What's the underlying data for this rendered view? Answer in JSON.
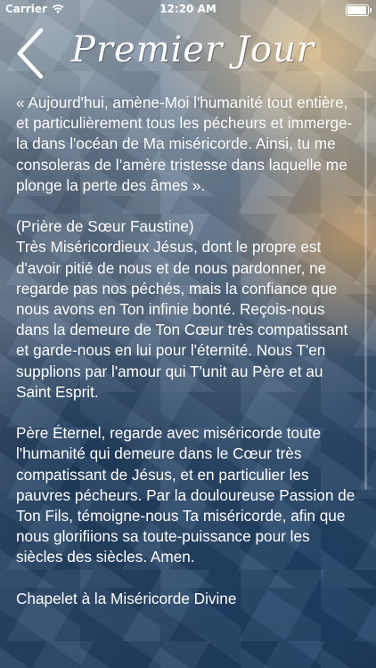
{
  "status_bar": {
    "carrier": "Carrier",
    "time": "12:20 AM"
  },
  "header": {
    "title": "Premier Jour"
  },
  "content": {
    "paragraph_1": "« Aujourd'hui, amène-Moi l'humanité tout entière, et particulièrement tous les pécheurs et immerge-la dans l'océan de Ma miséricorde. Ainsi, tu me consoleras de l’amère tristesse dans laquelle me plonge la perte des âmes ».",
    "prayer_heading": "(Prière de Sœur Faustine)",
    "prayer_body": "Très Miséricordieux Jésus, dont le propre est d'avoir pitié de nous et de nous pardonner, ne regarde pas nos péchés, mais la confiance que nous avons en Ton infinie bonté. Reçois-nous dans la demeure de Ton Cœur très compatissant et garde-nous en lui pour l'éternité. Nous T'en supplions par l'amour qui T'unit au Père et au Saint Esprit.",
    "paragraph_3": "Père Éternel, regarde avec miséricorde toute l'humanité qui demeure dans le Cœur très compatissant de Jésus,  et en particulier  les pauvres pécheurs. Par la douloureuse Passion de Ton Fils, témoigne-nous Ta miséricorde, afin que nous glorifiions sa toute-puissance pour les siècles des siècles. Amen.",
    "closing": "Chapelet à la Miséricorde Divine"
  }
}
